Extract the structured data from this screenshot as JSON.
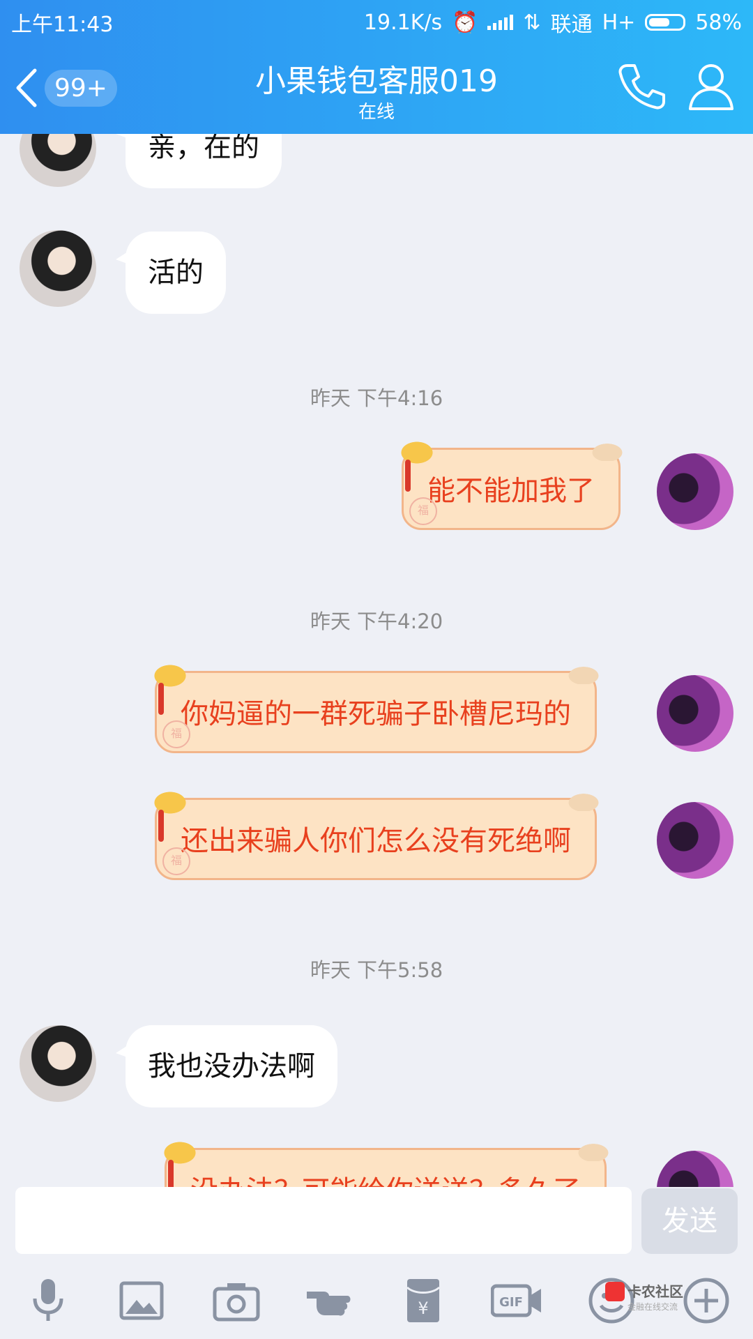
{
  "status_bar": {
    "time": "上午11:43",
    "speed": "19.1K/s",
    "carrier": "联通",
    "network": "H+",
    "battery": "58%"
  },
  "header": {
    "title": "小果钱包客服019",
    "status": "在线",
    "unread_badge": "99+"
  },
  "messages": [
    {
      "side": "left",
      "text": "亲，在的"
    },
    {
      "side": "left",
      "text": "活的"
    },
    {
      "timestamp": "昨天 下午4:16"
    },
    {
      "side": "right",
      "text": "能不能加我了"
    },
    {
      "timestamp": "昨天 下午4:20"
    },
    {
      "side": "right",
      "text": "你妈逼的一群死骗子卧槽尼玛的"
    },
    {
      "side": "right",
      "text": "还出来骗人你们怎么没有死绝啊"
    },
    {
      "timestamp": "昨天 下午5:58"
    },
    {
      "side": "left",
      "text": "我也没办法啊"
    },
    {
      "side": "right",
      "text": "没办法？可能给你送送？多久了"
    }
  ],
  "composer": {
    "input_value": "",
    "send_label": "发送"
  },
  "watermark": {
    "brand": "卡农社区",
    "slogan": "金融在线交流"
  },
  "colors": {
    "header_gradient_start": "#2f8ff0",
    "header_gradient_end": "#2db8f8",
    "chat_background": "#eef0f6",
    "outgoing_bubble_fill": "#fde3c4",
    "outgoing_text": "#e8401e"
  }
}
